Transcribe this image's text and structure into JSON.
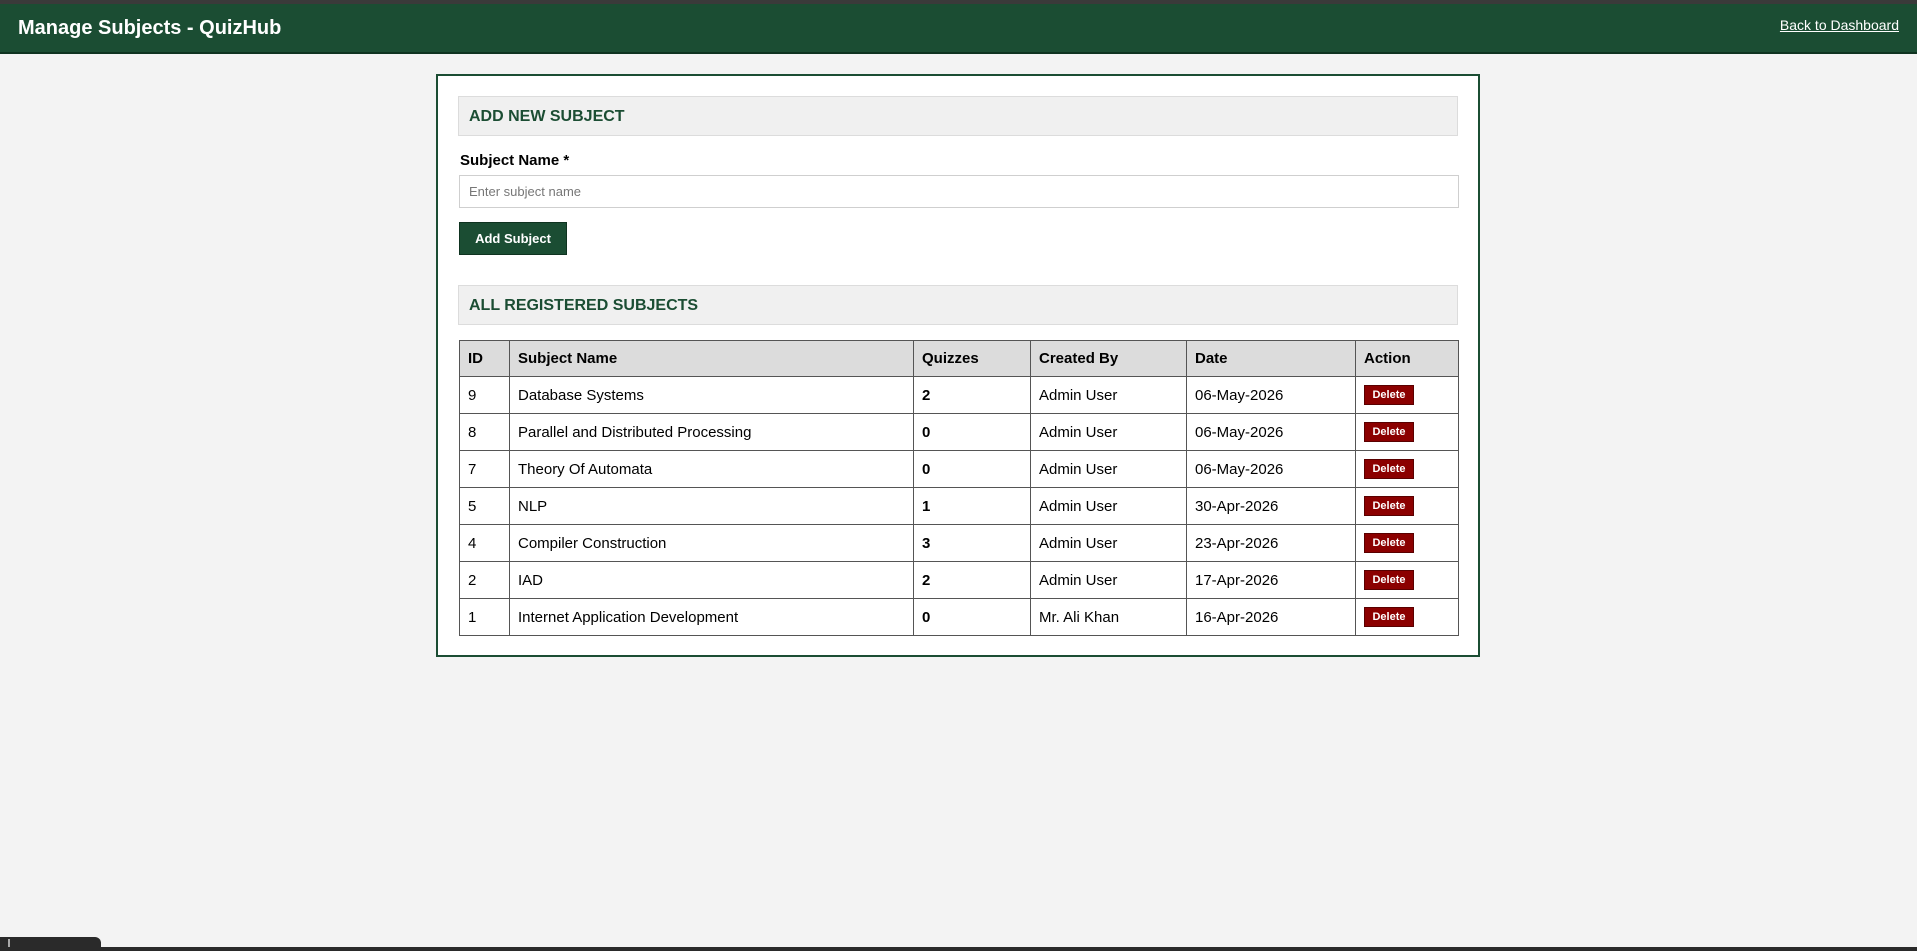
{
  "header": {
    "title": "Manage Subjects - QuizHub",
    "back_link": "Back to Dashboard"
  },
  "add_section": {
    "heading": "ADD NEW SUBJECT",
    "field_label": "Subject Name *",
    "placeholder": "Enter subject name",
    "value": "",
    "button_label": "Add Subject"
  },
  "list_section": {
    "heading": "ALL REGISTERED SUBJECTS",
    "columns": [
      "ID",
      "Subject Name",
      "Quizzes",
      "Created By",
      "Date",
      "Action"
    ],
    "delete_label": "Delete",
    "rows": [
      {
        "id": "9",
        "name": "Database Systems",
        "quizzes": "2",
        "created_by": "Admin User",
        "date": "06-May-2026"
      },
      {
        "id": "8",
        "name": "Parallel and Distributed Processing",
        "quizzes": "0",
        "created_by": "Admin User",
        "date": "06-May-2026"
      },
      {
        "id": "7",
        "name": "Theory Of Automata",
        "quizzes": "0",
        "created_by": "Admin User",
        "date": "06-May-2026"
      },
      {
        "id": "5",
        "name": "NLP",
        "quizzes": "1",
        "created_by": "Admin User",
        "date": "30-Apr-2026"
      },
      {
        "id": "4",
        "name": "Compiler Construction",
        "quizzes": "3",
        "created_by": "Admin User",
        "date": "23-Apr-2026"
      },
      {
        "id": "2",
        "name": "IAD",
        "quizzes": "2",
        "created_by": "Admin User",
        "date": "17-Apr-2026"
      },
      {
        "id": "1",
        "name": "Internet Application Development",
        "quizzes": "0",
        "created_by": "Mr. Ali Khan",
        "date": "16-Apr-2026"
      }
    ]
  },
  "colors": {
    "header_bg": "#1b4d33",
    "accent": "#1b4d33",
    "delete_button": "#8b0000",
    "page_bg": "#f3f3f3"
  }
}
